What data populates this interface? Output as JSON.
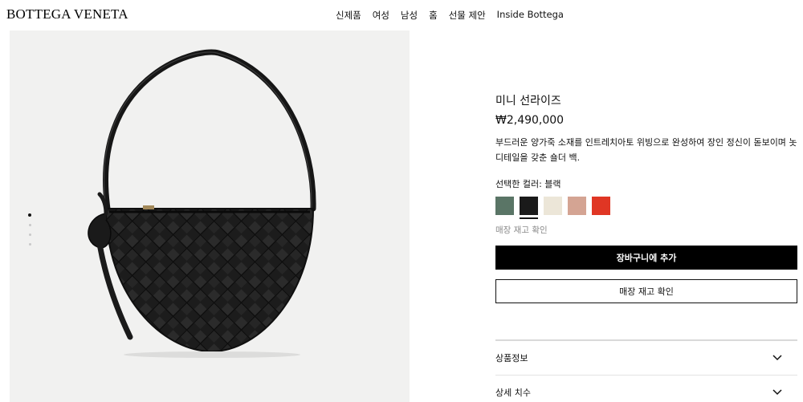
{
  "header": {
    "logo": "BOTTEGA VENETA",
    "nav": [
      "신제품",
      "여성",
      "남성",
      "홈",
      "선물 제안",
      "Inside Bottega"
    ]
  },
  "gallery": {
    "active_index": 0,
    "total": 4
  },
  "product": {
    "title": "미니 선라이즈",
    "price": "₩2,490,000",
    "description": "부드러운 양가죽 소재를 인트레치아토 위빙으로 완성하여 장인 정신이 돋보이며 놋 디테일을 갖춘 숄더 백.",
    "selected_color_label": "선택한 컬러: 블랙",
    "swatches": [
      {
        "name": "green",
        "color": "#5a7566"
      },
      {
        "name": "black",
        "color": "#1a1a1a",
        "selected": true
      },
      {
        "name": "cream",
        "color": "#ece6d8"
      },
      {
        "name": "pink",
        "color": "#d4a493"
      },
      {
        "name": "red",
        "color": "#e03624"
      }
    ],
    "stock_link": "매장 재고 확인",
    "add_to_cart": "장바구니에 추가",
    "check_stock": "매장 재고 확인"
  },
  "accordion": [
    {
      "label": "상품정보"
    },
    {
      "label": "상세 치수"
    }
  ]
}
